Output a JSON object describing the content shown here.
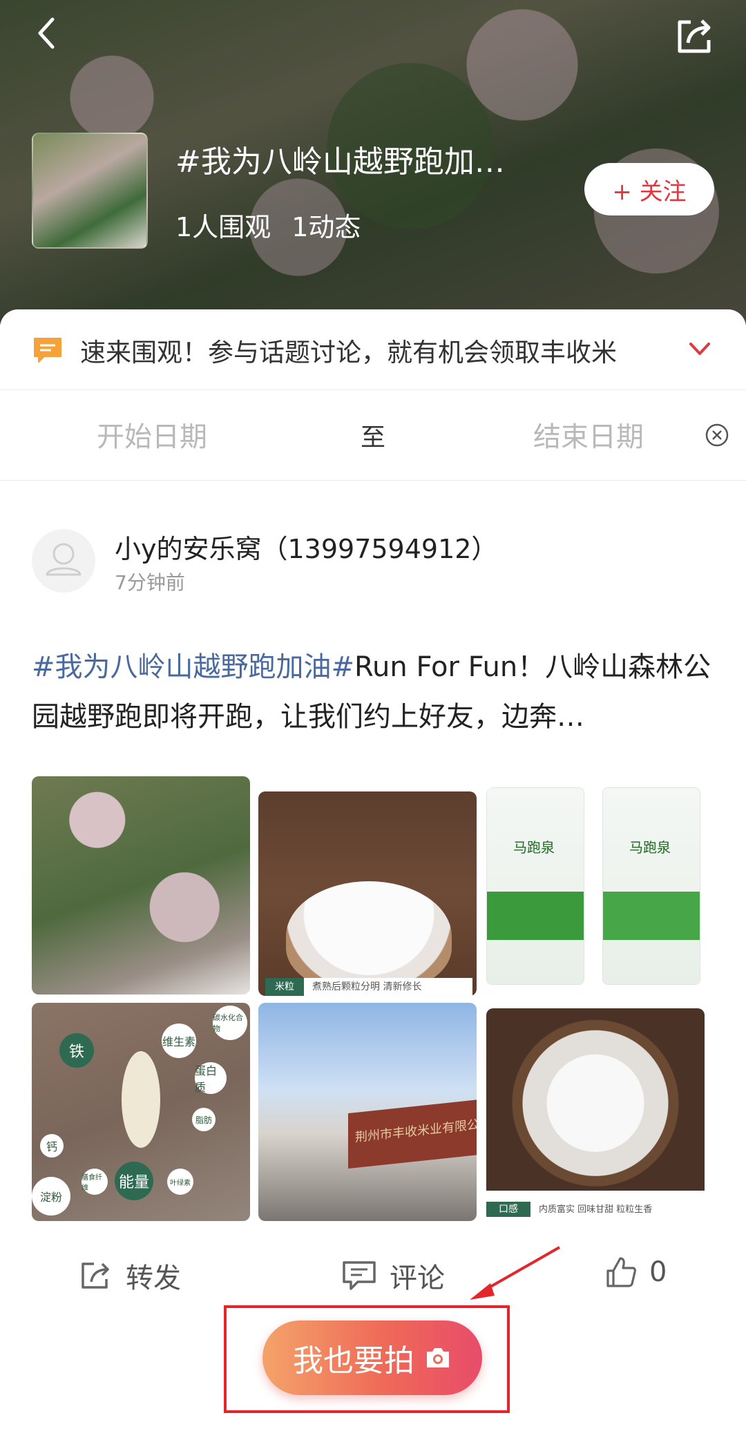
{
  "header": {
    "topic_title": "#我为八岭山越野跑加…",
    "stats": {
      "viewers": "1人围观",
      "posts": "1动态"
    },
    "follow_label": "+ 关注"
  },
  "notice": {
    "text": "速来围观！参与话题讨论，就有机会领取丰收米"
  },
  "date_filter": {
    "start_placeholder": "开始日期",
    "separator": "至",
    "end_placeholder": "结束日期"
  },
  "post": {
    "user_name": "小y的安乐窝（13997594912）",
    "time": "7分钟前",
    "tag": "#我为八岭山越野跑加油#",
    "body": "Run For Fun！八岭山森林公园越野跑即将开跑，让我们约上好友，边奔…",
    "image_texts": {
      "rice_caption_label": "米粒",
      "rice_caption_text": "煮熟后颗粒分明 清新修长",
      "bag_brand": "马跑泉",
      "nutrients": [
        "铁",
        "维生素",
        "碳水化合物",
        "蛋白质",
        "脂肪",
        "钙",
        "能量",
        "膳食纤维",
        "叶绿素",
        "淀粉"
      ],
      "company_sign": "荆州市丰收米业有限公",
      "taste_label": "口感",
      "taste_text": "内质富实 回味甘甜 粒粒生香"
    },
    "actions": {
      "forward": "转发",
      "comment": "评论",
      "likes": "0"
    }
  },
  "cta": {
    "label": "我也要拍"
  },
  "colors": {
    "accent": "#e0383e",
    "tag_blue": "#4a6a9e",
    "cta_start": "#f4a36a",
    "cta_end": "#e84c6a"
  }
}
